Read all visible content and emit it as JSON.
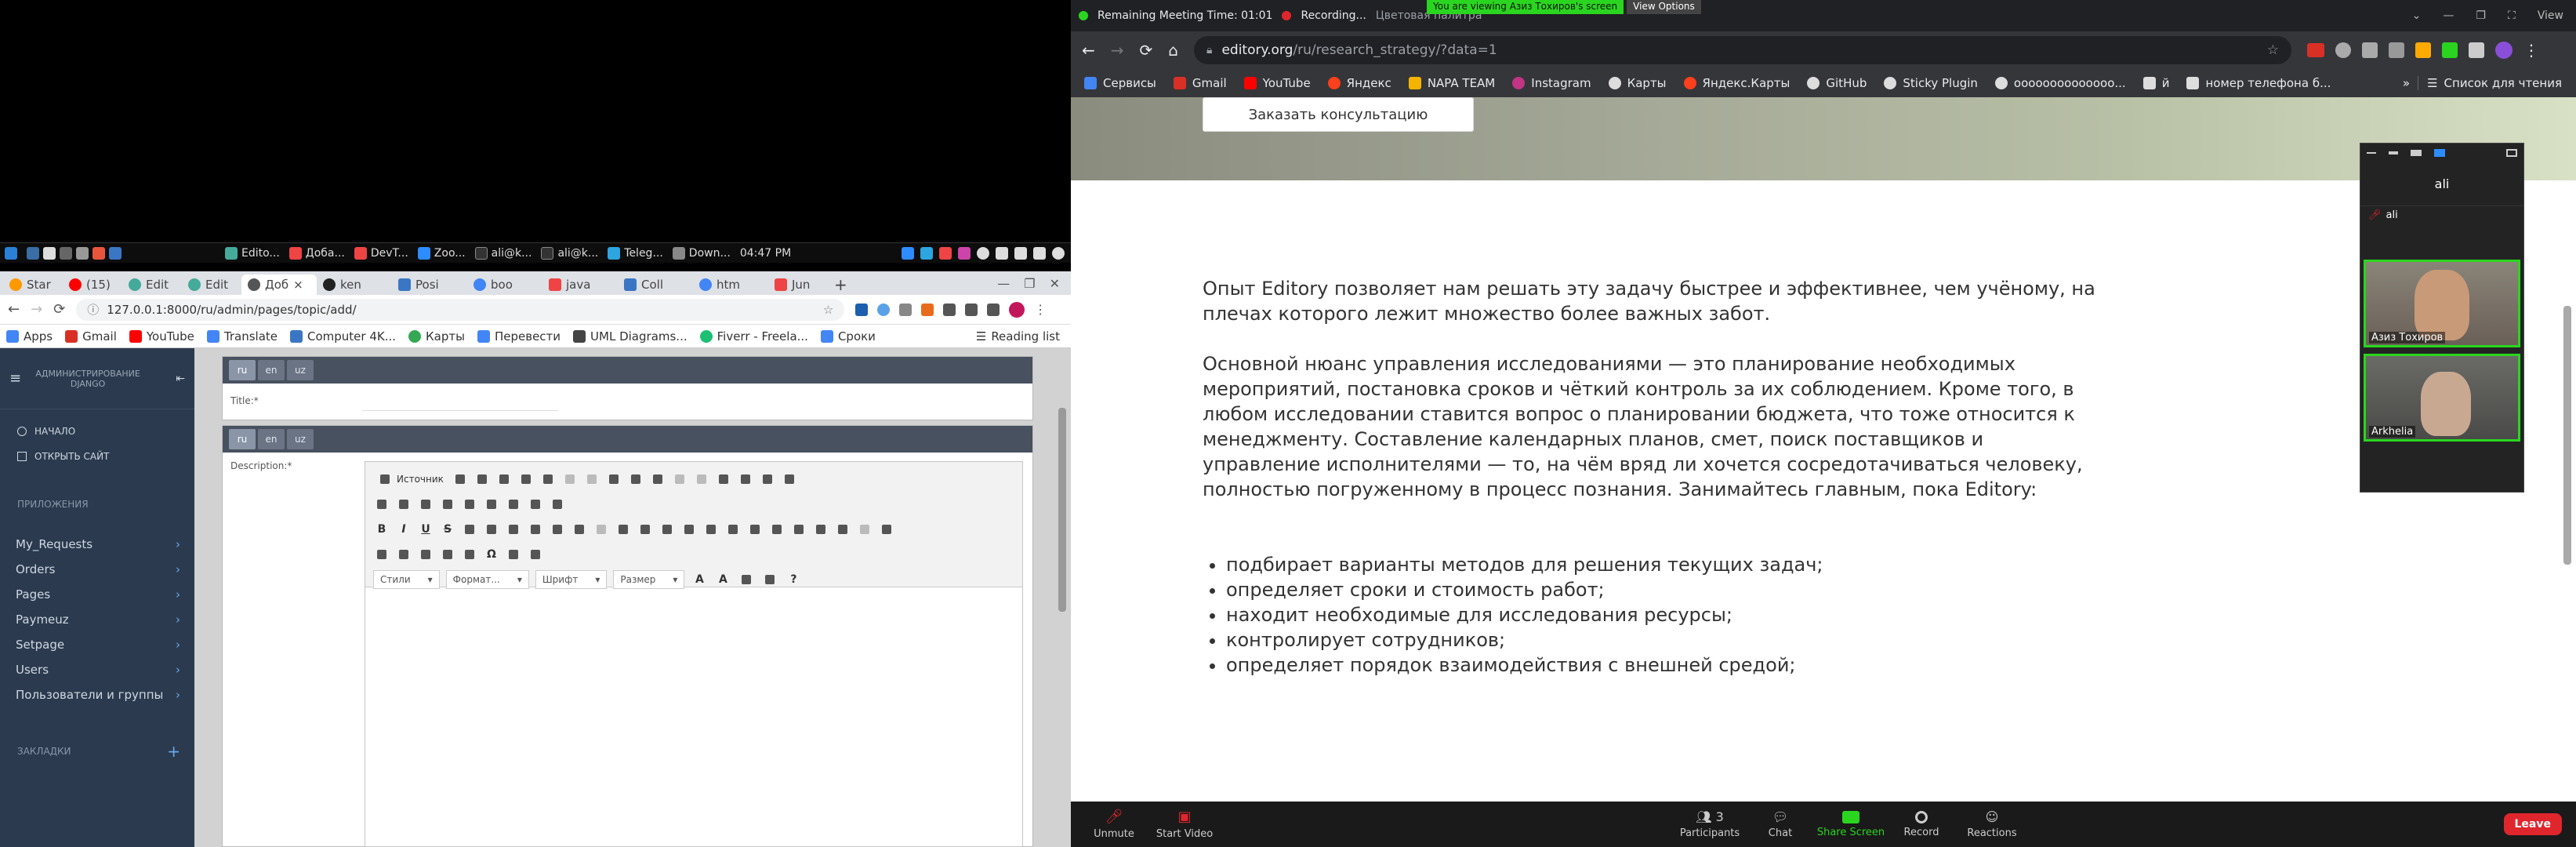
{
  "taskbar": {
    "items": [
      "Edito...",
      "Доба...",
      "DevT...",
      "Zoo...",
      "ali@k...",
      "ali@k...",
      "Teleg...",
      "Down..."
    ],
    "clock": "04:47 PM"
  },
  "left_tabs": [
    "Star",
    "(15)",
    "Edit",
    "Edit",
    "Доб",
    "ken",
    "Posi",
    "boo",
    "java",
    "Coll",
    "htm",
    "Jun"
  ],
  "left_url": "127.0.0.1:8000/ru/admin/pages/topic/add/",
  "left_bookmarks": [
    "Apps",
    "Gmail",
    "YouTube",
    "Translate",
    "Computer 4K...",
    "Карты",
    "Перевести",
    "UML Diagrams...",
    "Fiverr - Freela...",
    "Сроки"
  ],
  "left_reading_list": "Reading list",
  "admin": {
    "brand": "АДМИНИСТРИРОВАНИЕ DJANGO",
    "nav1": "НАЧАЛО",
    "nav2": "ОТКРЫТЬ САЙТ",
    "apps_heading": "ПРИЛОЖЕНИЯ",
    "menu": [
      "My_Requests",
      "Orders",
      "Pages",
      "Paymeuz",
      "Setpage",
      "Users",
      "Пользователи и группы"
    ],
    "bookmarks_heading": "ЗАКЛАДКИ",
    "langs": [
      "ru",
      "en",
      "uz"
    ],
    "title_label": "Title:*",
    "desc_label": "Description:*",
    "source_btn": "Источник",
    "styles": "Стили",
    "format": "Формат...",
    "font": "Шрифт",
    "size": "Размер"
  },
  "zoom": {
    "meeting_time": "Remaining Meeting Time: 01:01",
    "recording": "Recording...",
    "viewing_banner": "You are viewing Азиз Тохиров's screen",
    "view_options": "View Options",
    "view": "View",
    "tab_title": "Цветовая палитра",
    "gallery_name": "ali",
    "self_label": "ali",
    "p1": "Азиз Тохиров",
    "p2": "Arkhelia",
    "participants_count": "3",
    "buttons": [
      "Unmute",
      "Start Video",
      "Participants",
      "Chat",
      "Share Screen",
      "Record",
      "Reactions"
    ],
    "leave": "Leave"
  },
  "right_url_host": "editory.org",
  "right_url_path": "/ru/research_strategy/?data=1",
  "right_bookmarks": [
    "Сервисы",
    "Gmail",
    "YouTube",
    "Яндекс",
    "NAPA TEAM",
    "Instagram",
    "Карты",
    "Яндекс.Карты",
    "GitHub",
    "Sticky Plugin",
    "оооооооооооооо...",
    "й",
    "номер телефона б..."
  ],
  "right_reading_list": "Список для чтения",
  "page": {
    "button": "Заказать консультацию",
    "p1": "Опыт Editory позволяет нам решать эту задачу быстрее и эффективнее, чем учёному, на плечах которого лежит множество более важных забот.",
    "p2": "Основной нюанс управления исследованиями — это планирование необходимых мероприятий, постановка сроков и чёткий контроль за их соблюдением. Кроме того, в любом исследовании ставится вопрос о планировании бюджета, что тоже относится к менеджменту. Составление календарных планов, смет, поиск поставщиков и управление исполнителями — то, на чём вряд ли хочется сосредотачиваться человеку, полностью погруженному в процесс познания. Занимайтесь главным, пока Editory:",
    "bullets": [
      "подбирает варианты методов для решения текущих задач;",
      "определяет сроки и стоимость работ;",
      "находит необходимые для исследования ресурсы;",
      "контролирует сотрудников;",
      "определяет порядок взаимодействия с внешней средой;"
    ]
  },
  "colors": {
    "zoom_green": "#2ad51f",
    "leave_red": "#e0262d",
    "admin_sidebar": "#2b3a4e"
  }
}
